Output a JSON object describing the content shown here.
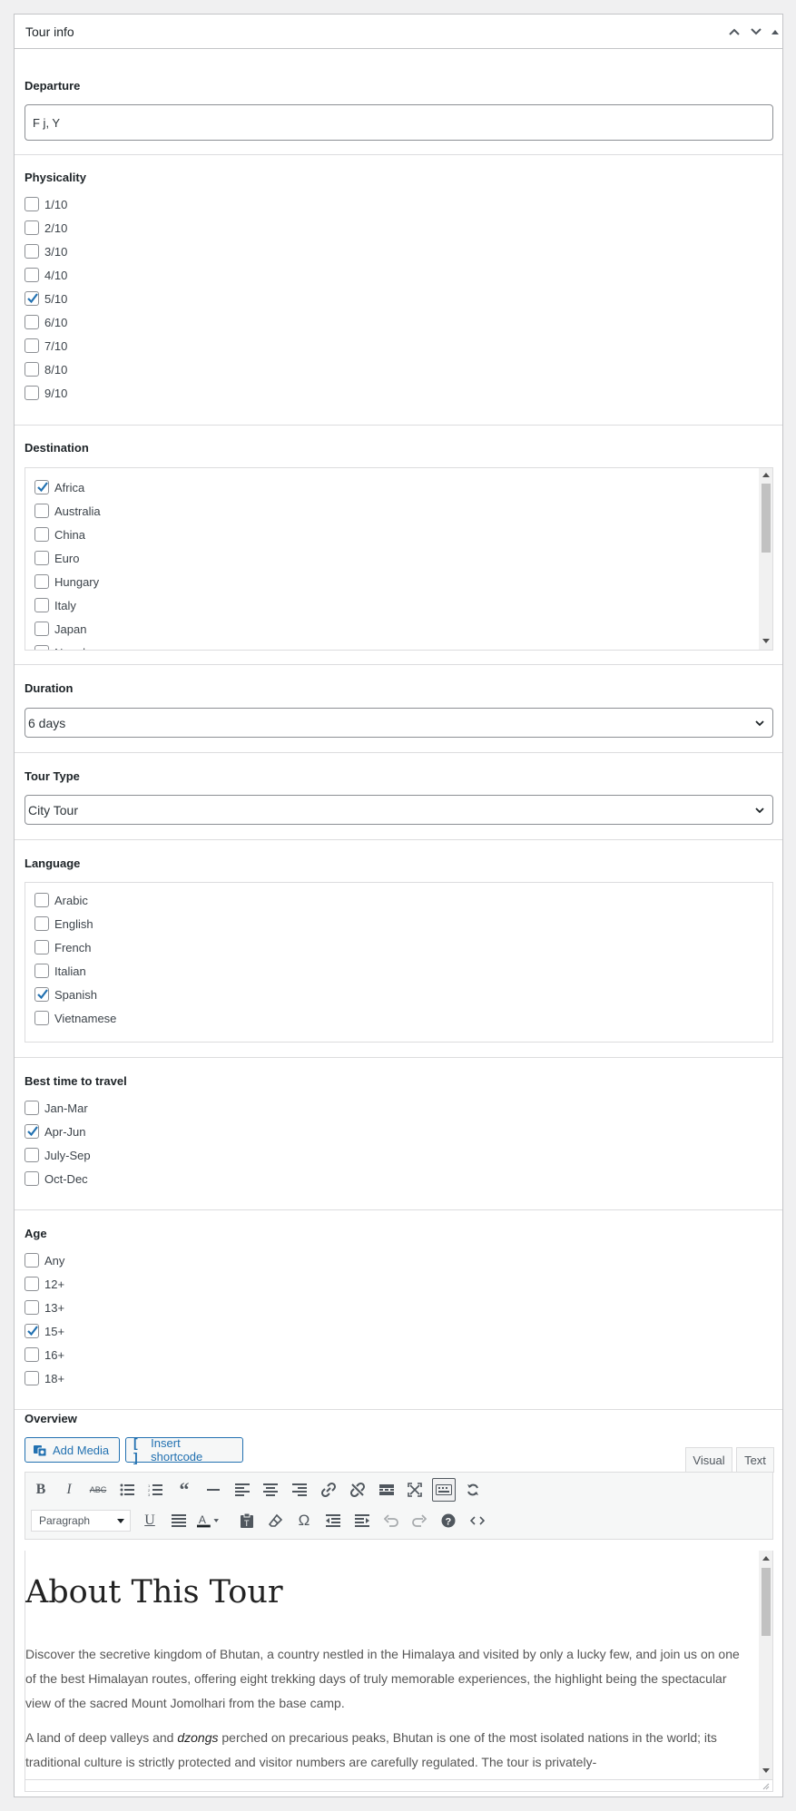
{
  "panel": {
    "title": "Tour info"
  },
  "departure": {
    "label": "Departure",
    "value": "F j, Y"
  },
  "physicality": {
    "label": "Physicality",
    "options": [
      {
        "label": "1/10",
        "checked": false
      },
      {
        "label": "2/10",
        "checked": false
      },
      {
        "label": "3/10",
        "checked": false
      },
      {
        "label": "4/10",
        "checked": false
      },
      {
        "label": "5/10",
        "checked": true
      },
      {
        "label": "6/10",
        "checked": false
      },
      {
        "label": "7/10",
        "checked": false
      },
      {
        "label": "8/10",
        "checked": false
      },
      {
        "label": "9/10",
        "checked": false
      }
    ]
  },
  "destination": {
    "label": "Destination",
    "options": [
      {
        "label": "Africa",
        "checked": true
      },
      {
        "label": "Australia",
        "checked": false
      },
      {
        "label": "China",
        "checked": false
      },
      {
        "label": "Euro",
        "checked": false
      },
      {
        "label": "Hungary",
        "checked": false
      },
      {
        "label": "Italy",
        "checked": false
      },
      {
        "label": "Japan",
        "checked": false
      },
      {
        "label": "Nepal",
        "checked": false
      }
    ]
  },
  "duration": {
    "label": "Duration",
    "value": "6 days"
  },
  "tour_type": {
    "label": "Tour Type",
    "value": "City Tour"
  },
  "language": {
    "label": "Language",
    "options": [
      {
        "label": "Arabic",
        "checked": false
      },
      {
        "label": "English",
        "checked": false
      },
      {
        "label": "French",
        "checked": false
      },
      {
        "label": "Italian",
        "checked": false
      },
      {
        "label": "Spanish",
        "checked": true
      },
      {
        "label": "Vietnamese",
        "checked": false
      }
    ]
  },
  "best_time": {
    "label": "Best time to travel",
    "options": [
      {
        "label": "Jan-Mar",
        "checked": false
      },
      {
        "label": "Apr-Jun",
        "checked": true
      },
      {
        "label": "July-Sep",
        "checked": false
      },
      {
        "label": "Oct-Dec",
        "checked": false
      }
    ]
  },
  "age": {
    "label": "Age",
    "options": [
      {
        "label": "Any",
        "checked": false
      },
      {
        "label": "12+",
        "checked": false
      },
      {
        "label": "13+",
        "checked": false
      },
      {
        "label": "15+",
        "checked": true
      },
      {
        "label": "16+",
        "checked": false
      },
      {
        "label": "18+",
        "checked": false
      }
    ]
  },
  "overview": {
    "label": "Overview",
    "add_media": "Add Media",
    "insert_shortcode": "Insert shortcode",
    "tab_visual": "Visual",
    "tab_text": "Text",
    "format_select": "Paragraph",
    "content": {
      "heading": "About This Tour",
      "p1": "Discover the secretive kingdom of Bhutan, a country nestled in the Himalaya and visited by only a lucky few, and join us on one of the best Himalayan routes, offering eight trekking days of truly memorable experiences, the highlight being the spectacular view of the sacred Mount Jomolhari from the base camp.",
      "p2_before": "A land of deep valleys and ",
      "p2_em": "dzongs",
      "p2_after": " perched on precarious peaks, Bhutan is one of the most isolated nations in the world; its traditional culture is strictly protected and visitor numbers are carefully regulated. The tour is privately-"
    }
  },
  "colors": {
    "accent": "#2271b1",
    "border": "#c3c4c7",
    "check": "#2271b1"
  }
}
